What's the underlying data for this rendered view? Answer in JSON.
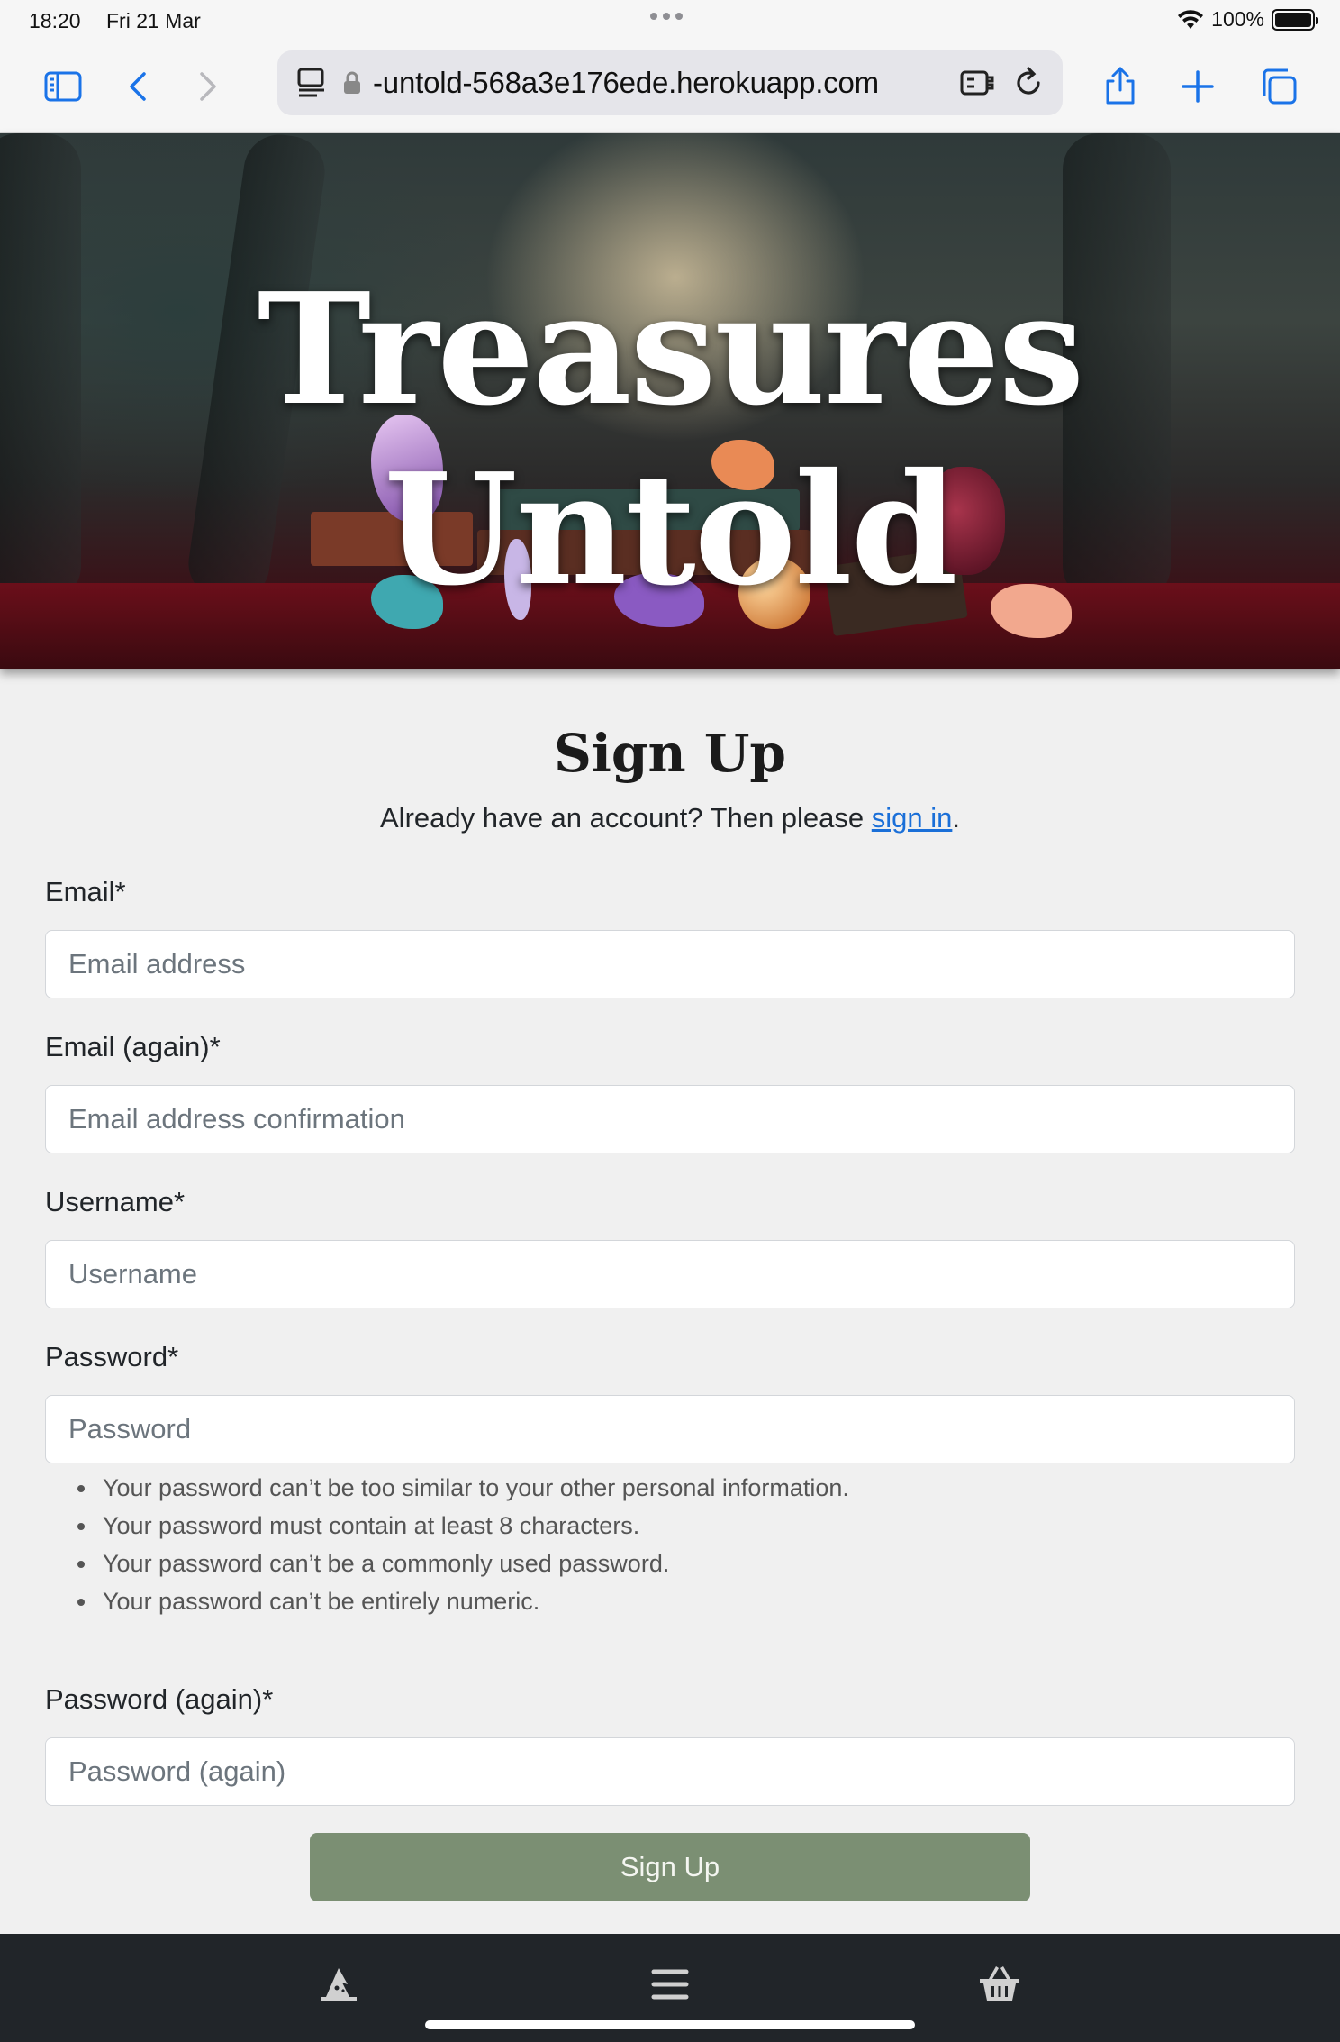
{
  "status_bar": {
    "time": "18:20",
    "date": "Fri 21 Mar",
    "battery": "100%",
    "battery_level": 1.0
  },
  "browser": {
    "url": "-untold-568a3e176ede.herokuapp.com",
    "icons": [
      "sidebar-icon",
      "back-icon",
      "forward-icon",
      "reader-icon",
      "lock-icon",
      "extension-icon",
      "reload-icon",
      "share-icon",
      "new-tab-icon",
      "tabs-icon"
    ],
    "accent_color": "#1a73e8"
  },
  "hero": {
    "title": "Treasures Untold"
  },
  "form": {
    "title": "Sign Up",
    "intro_before": "Already have an account? Then please ",
    "intro_link": "sign in",
    "intro_after": ".",
    "fields": {
      "email": {
        "label": "Email*",
        "placeholder": "Email address"
      },
      "email_again": {
        "label": "Email (again)*",
        "placeholder": "Email address confirmation"
      },
      "username": {
        "label": "Username*",
        "placeholder": "Username"
      },
      "password": {
        "label": "Password*",
        "placeholder": "Password"
      },
      "password_again": {
        "label": "Password (again)*",
        "placeholder": "Password (again)"
      }
    },
    "password_help": [
      "Your password can’t be too similar to your other personal information.",
      "Your password must contain at least 8 characters.",
      "Your password can’t be a commonly used password.",
      "Your password can’t be entirely numeric."
    ],
    "submit_label": "Sign Up",
    "submit_color": "#7b8f73"
  },
  "bottom_nav": {
    "items": [
      "wizard-hat-icon",
      "menu-icon",
      "basket-icon"
    ],
    "background": "#212529"
  }
}
